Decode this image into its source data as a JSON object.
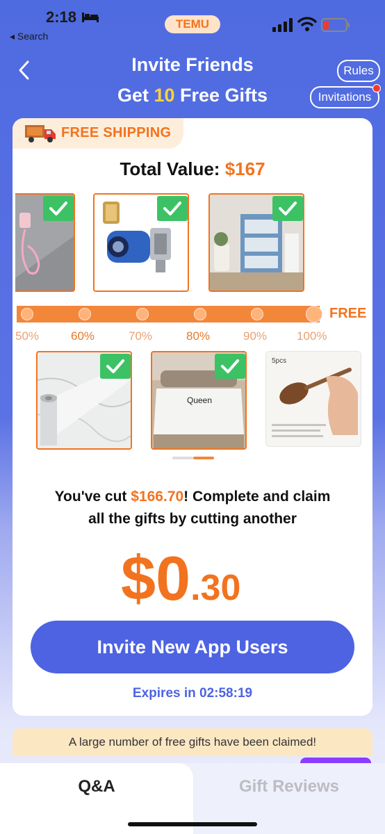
{
  "status": {
    "time": "2:18",
    "back_label": "◂ Search",
    "app_badge": "TEMU"
  },
  "header": {
    "title": "Invite Friends",
    "subtitle_pre": "Get ",
    "subtitle_num": "10",
    "subtitle_post": " Free Gifts",
    "rules": "Rules",
    "invitations": "Invitations"
  },
  "card": {
    "shipping_badge": "FREE SHIPPING",
    "total_label": "Total Value: ",
    "total_value": "$167",
    "progress_end_label": "FREE",
    "progress_ticks": [
      "50%",
      "60%",
      "70%",
      "80%",
      "90%",
      "100%"
    ],
    "items": [
      {
        "name": "phone-case",
        "claimed": true
      },
      {
        "name": "socket-wrench",
        "claimed": true
      },
      {
        "name": "storage-shelf",
        "claimed": true
      },
      {
        "name": "marble-contact-paper",
        "claimed": true
      },
      {
        "name": "bed-sheet",
        "claimed": true,
        "label": "Queen"
      },
      {
        "name": "wooden-spoon",
        "claimed": false,
        "label": "5pcs"
      }
    ],
    "cut_line1_pre": "You've cut ",
    "cut_amount": "$166.70",
    "cut_line1_post": "! Complete and claim",
    "cut_line2": "all the gifts by cutting another",
    "remaining_dollars": "$0",
    "remaining_cents": ".30",
    "invite_button": "Invite New App Users",
    "expires": "Expires in 02:58:19"
  },
  "banner": {
    "claimed_text": "A large number of free gifts have been claimed!"
  },
  "tabs": [
    {
      "label": "Q&A"
    },
    {
      "label": "Gift Reviews"
    }
  ],
  "colors": {
    "accent": "#f2731f",
    "primary": "#4d63e2",
    "check": "#3cc264"
  }
}
